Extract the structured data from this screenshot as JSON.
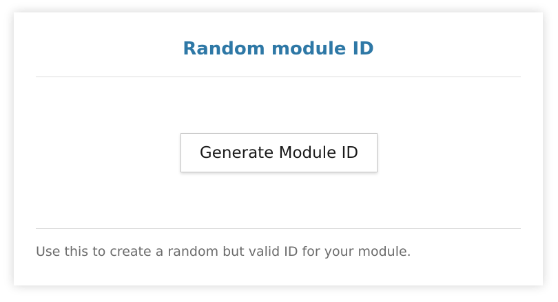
{
  "card": {
    "title": "Random module ID",
    "button_label": "Generate Module ID",
    "footer_text": "Use this to create a random but valid ID for your module."
  },
  "colors": {
    "title": "#2e78a6",
    "divider": "#dcdcdc",
    "footer_text": "#6b6b6b"
  }
}
